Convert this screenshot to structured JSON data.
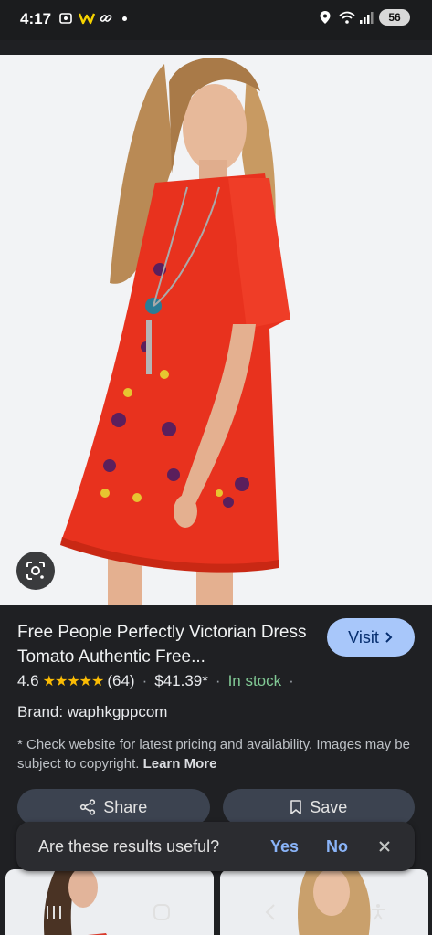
{
  "status_bar": {
    "time": "4:17",
    "battery": "56",
    "icons": [
      "screenshot-icon",
      "w-app-icon",
      "link-icon",
      "location-icon",
      "wifi-icon",
      "signal-icon"
    ]
  },
  "product": {
    "title": "Free People Perfectly Victorian Dress Tomato Authentic Free...",
    "visit_label": "Visit",
    "rating": "4.6",
    "stars": "★★★★★",
    "reviews": "(64)",
    "price": "$41.39*",
    "stock": "In stock",
    "brand": "Brand: waphkgppcom",
    "disclaimer": "* Check website for latest pricing and availability. Images may be subject to copyright.",
    "learn_more": "Learn More",
    "share_label": "Share",
    "save_label": "Save"
  },
  "feedback": {
    "question": "Are these results useful?",
    "yes": "Yes",
    "no": "No"
  },
  "colors": {
    "accent": "#a8c7fa",
    "stock_green": "#81c995",
    "star_yellow": "#fbbc04",
    "dress_red": "#e8321e"
  }
}
